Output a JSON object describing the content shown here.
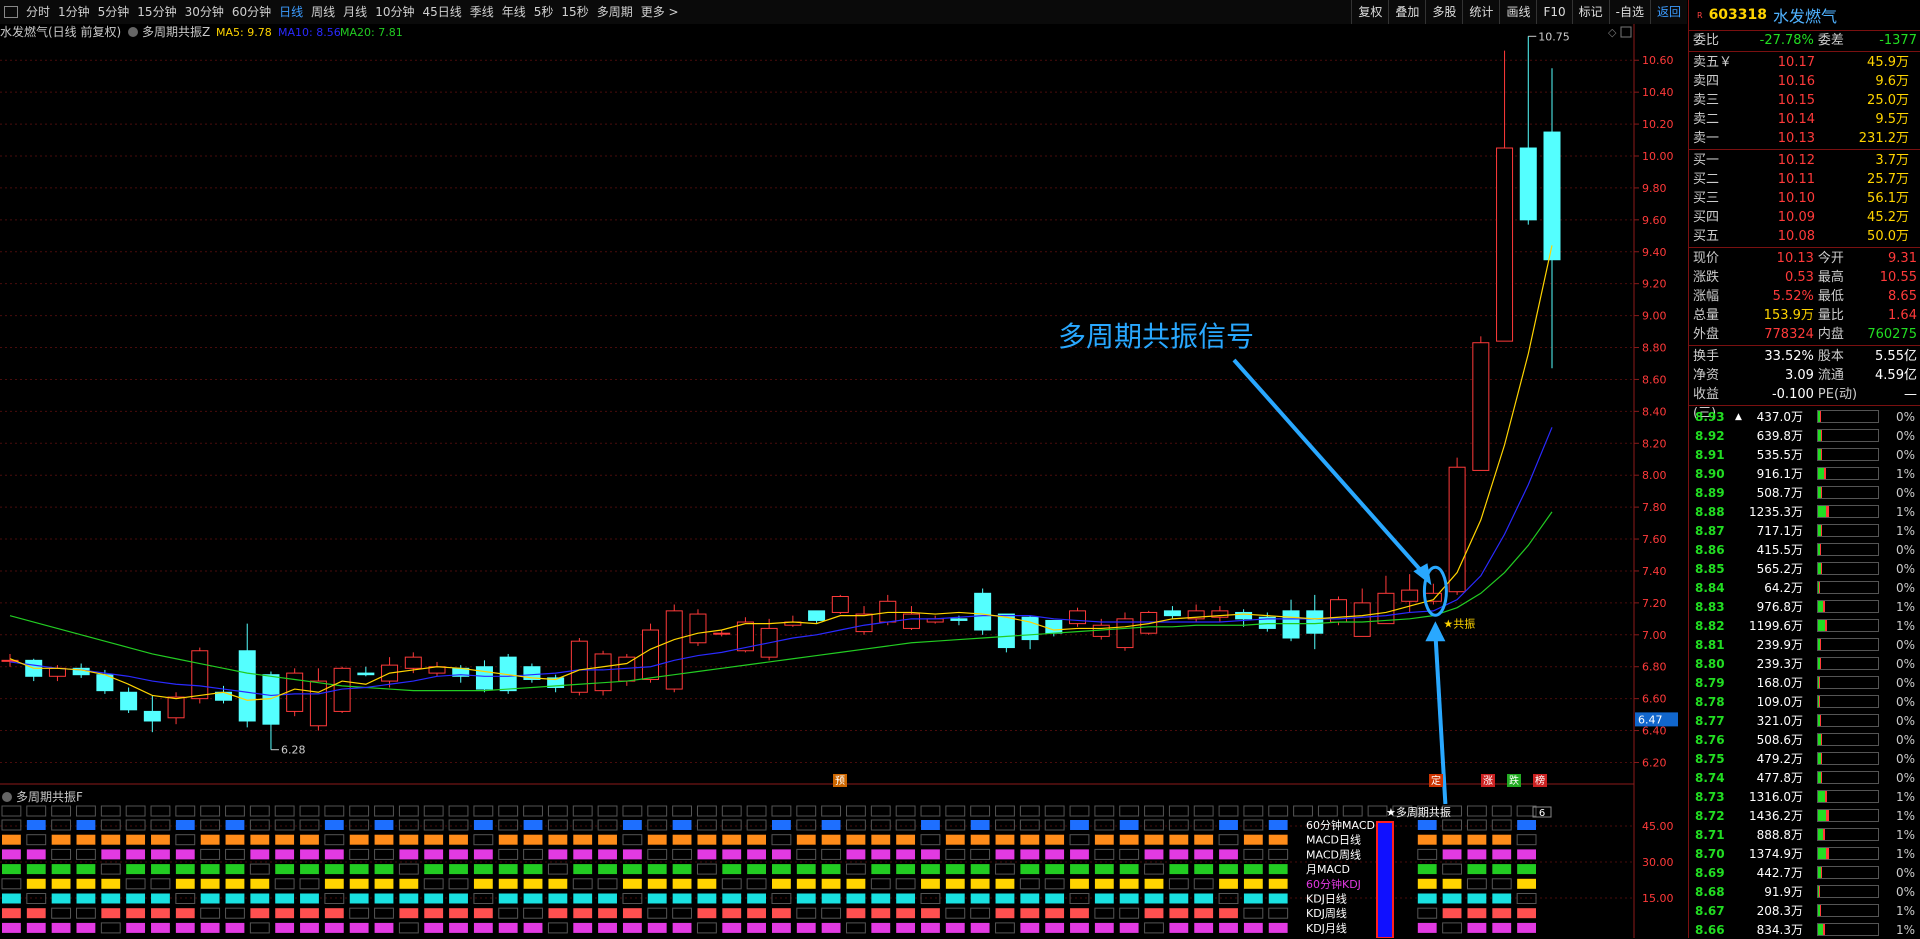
{
  "toolbar": {
    "items": [
      "分时",
      "1分钟",
      "5分钟",
      "15分钟",
      "30分钟",
      "60分钟",
      "日线",
      "周线",
      "月线",
      "10分钟",
      "45日线",
      "季线",
      "年线",
      "5秒",
      "15秒",
      "多周期",
      "更多 >"
    ],
    "active": "日线",
    "right": [
      "复权",
      "叠加",
      "多股",
      "统计",
      "画线",
      "F10",
      "标记",
      "-自选",
      "返回"
    ]
  },
  "chart_header": {
    "title": "水发燃气(日线 前复权)",
    "indicator": "多周期共振Z",
    "ma5": "MA5: 9.78",
    "ma10": "MA10: 8.56",
    "ma20": "MA20: 7.81"
  },
  "price_axis": [
    "10.60",
    "10.40",
    "10.20",
    "10.00",
    "9.80",
    "9.60",
    "9.40",
    "9.20",
    "9.00",
    "8.80",
    "8.60",
    "8.40",
    "8.20",
    "8.00",
    "7.80",
    "7.60",
    "7.40",
    "7.20",
    "7.00",
    "6.80",
    "6.60",
    "6.40",
    "6.20"
  ],
  "price_marker": "6.47",
  "annotations": {
    "high": "10.75",
    "low": "6.28",
    "signal": "多周期共振信号",
    "gongzhen": "★共振",
    "sub_signal": "★多周期共振"
  },
  "tags": [
    "预",
    "定",
    "涨",
    "跌",
    "榜"
  ],
  "chart_data": {
    "type": "candlestick",
    "opens": [
      6.84,
      6.84,
      6.74,
      6.79,
      6.75,
      6.64,
      6.52,
      6.48,
      6.6,
      6.64,
      6.9,
      6.75,
      6.52,
      6.43,
      6.52,
      6.76,
      6.71,
      6.79,
      6.76,
      6.79,
      6.8,
      6.86,
      6.8,
      6.73,
      6.64,
      6.65,
      6.71,
      6.72,
      6.66,
      6.95,
      7.01,
      6.9,
      6.86,
      7.06,
      7.15,
      7.14,
      7.02,
      7.08,
      7.04,
      7.08,
      7.1,
      7.26,
      7.13,
      7.11,
      7.09,
      7.07,
      6.99,
      6.92,
      7.01,
      7.15,
      7.1,
      7.11,
      7.14,
      7.11,
      7.15,
      7.15,
      7.08,
      6.99,
      7.07,
      7.21,
      7.21,
      7.27,
      8.03,
      8.84,
      10.05,
      10.15
    ],
    "closes": [
      6.84,
      6.74,
      6.79,
      6.75,
      6.65,
      6.53,
      6.46,
      6.61,
      6.9,
      6.59,
      6.46,
      6.44,
      6.76,
      6.71,
      6.79,
      6.75,
      6.81,
      6.86,
      6.8,
      6.74,
      6.66,
      6.65,
      6.72,
      6.67,
      6.96,
      6.88,
      6.86,
      7.03,
      7.15,
      7.13,
      7.01,
      7.08,
      7.04,
      7.08,
      7.09,
      7.24,
      7.13,
      7.21,
      7.13,
      7.1,
      7.09,
      7.03,
      6.92,
      6.97,
      7.01,
      7.15,
      7.06,
      7.1,
      7.14,
      7.12,
      7.15,
      7.15,
      7.1,
      7.04,
      6.98,
      7.01,
      7.22,
      7.2,
      7.26,
      7.28,
      7.26,
      8.05,
      8.83,
      10.05,
      9.6,
      9.35
    ],
    "highs": [
      6.88,
      6.85,
      6.81,
      6.82,
      6.78,
      6.67,
      6.62,
      6.64,
      6.92,
      6.68,
      7.07,
      6.77,
      6.79,
      6.79,
      6.8,
      6.8,
      6.86,
      6.89,
      6.83,
      6.81,
      6.84,
      6.88,
      6.82,
      6.75,
      6.98,
      6.9,
      6.88,
      7.07,
      7.19,
      7.16,
      7.03,
      7.11,
      7.1,
      7.12,
      7.14,
      7.25,
      7.18,
      7.25,
      7.18,
      7.12,
      7.12,
      7.29,
      7.13,
      7.12,
      7.07,
      7.17,
      7.1,
      7.14,
      7.15,
      7.18,
      7.19,
      7.18,
      7.16,
      7.14,
      7.22,
      7.25,
      7.24,
      7.29,
      7.37,
      7.38,
      7.32,
      8.11,
      8.87,
      10.66,
      10.75,
      10.55
    ],
    "lows": [
      6.8,
      6.71,
      6.71,
      6.73,
      6.63,
      6.51,
      6.39,
      6.44,
      6.57,
      6.57,
      6.42,
      6.28,
      6.49,
      6.4,
      6.51,
      6.74,
      6.67,
      6.76,
      6.74,
      6.7,
      6.64,
      6.63,
      6.7,
      6.64,
      6.62,
      6.62,
      6.68,
      6.7,
      6.64,
      6.93,
      6.99,
      6.89,
      6.84,
      7.05,
      7.07,
      7.13,
      7.0,
      7.06,
      7.03,
      7.07,
      7.06,
      7.0,
      6.89,
      6.91,
      6.99,
      7.05,
      6.97,
      6.9,
      7.0,
      7.1,
      7.08,
      7.08,
      7.05,
      7.02,
      6.96,
      6.91,
      7.06,
      7.08,
      7.18,
      7.14,
      7.19,
      7.25,
      8.27,
      8.84,
      9.57,
      8.67
    ],
    "ma5": [
      6.85,
      6.79,
      6.79,
      6.78,
      6.75,
      6.69,
      6.62,
      6.6,
      6.62,
      6.64,
      6.59,
      6.6,
      6.66,
      6.64,
      6.71,
      6.69,
      6.76,
      6.78,
      6.8,
      6.79,
      6.77,
      6.75,
      6.73,
      6.72,
      6.78,
      6.8,
      6.82,
      6.91,
      6.97,
      7.01,
      7.03,
      7.07,
      7.07,
      7.08,
      7.07,
      7.12,
      7.12,
      7.14,
      7.14,
      7.13,
      7.14,
      7.13,
      7.11,
      7.08,
      7.03,
      7.04,
      7.04,
      7.05,
      7.07,
      7.1,
      7.11,
      7.12,
      7.13,
      7.12,
      7.11,
      7.1,
      7.11,
      7.12,
      7.14,
      7.18,
      7.22,
      7.39,
      7.72,
      8.19,
      8.76,
      9.44
    ],
    "ma10": [
      6.83,
      6.81,
      6.79,
      6.78,
      6.76,
      6.74,
      6.71,
      6.69,
      6.68,
      6.66,
      6.64,
      6.62,
      6.63,
      6.63,
      6.66,
      6.67,
      6.69,
      6.71,
      6.74,
      6.75,
      6.74,
      6.74,
      6.75,
      6.76,
      6.78,
      6.78,
      6.79,
      6.8,
      6.84,
      6.87,
      6.89,
      6.92,
      6.95,
      6.98,
      7.0,
      7.03,
      7.06,
      7.08,
      7.1,
      7.1,
      7.11,
      7.12,
      7.12,
      7.12,
      7.1,
      7.09,
      7.08,
      7.08,
      7.08,
      7.08,
      7.08,
      7.08,
      7.09,
      7.1,
      7.1,
      7.1,
      7.1,
      7.11,
      7.12,
      7.14,
      7.15,
      7.22,
      7.37,
      7.63,
      7.94,
      8.3
    ],
    "ma20": [
      7.12,
      7.08,
      7.04,
      7.0,
      6.96,
      6.92,
      6.88,
      6.85,
      6.82,
      6.79,
      6.76,
      6.74,
      6.72,
      6.7,
      6.68,
      6.67,
      6.66,
      6.65,
      6.65,
      6.65,
      6.65,
      6.66,
      6.67,
      6.68,
      6.69,
      6.7,
      6.71,
      6.73,
      6.75,
      6.77,
      6.79,
      6.81,
      6.83,
      6.85,
      6.87,
      6.89,
      6.91,
      6.93,
      6.95,
      6.96,
      6.97,
      6.98,
      6.99,
      7.0,
      7.01,
      7.02,
      7.03,
      7.04,
      7.05,
      7.05,
      7.06,
      7.06,
      7.06,
      7.07,
      7.07,
      7.07,
      7.08,
      7.08,
      7.09,
      7.1,
      7.12,
      7.17,
      7.26,
      7.39,
      7.56,
      7.77
    ]
  },
  "sub_panel": {
    "title": "多周期共振F",
    "axis": [
      "45.00",
      "30.00",
      "15.00"
    ],
    "rows": [
      "60分钟MACD",
      "MACD日线",
      "MACD周线",
      "月MACD",
      "60分钟KDJ",
      "KDJ日线",
      "KDJ周线",
      "KDJ月线"
    ],
    "count": "6"
  },
  "side": {
    "code": "603318",
    "name": "水发燃气",
    "r": "R",
    "weibi": {
      "label": "委比",
      "value": "-27.78%",
      "diff_label": "委差",
      "diff": "-1377"
    },
    "asks": [
      {
        "label": "卖五￥",
        "price": "10.17",
        "vol": "45.9万"
      },
      {
        "label": "卖四",
        "price": "10.16",
        "vol": "9.6万"
      },
      {
        "label": "卖三",
        "price": "10.15",
        "vol": "25.0万"
      },
      {
        "label": "卖二",
        "price": "10.14",
        "vol": "9.5万"
      },
      {
        "label": "卖一",
        "price": "10.13",
        "vol": "231.2万"
      }
    ],
    "bids": [
      {
        "label": "买一",
        "price": "10.12",
        "vol": "3.7万"
      },
      {
        "label": "买二",
        "price": "10.11",
        "vol": "25.7万"
      },
      {
        "label": "买三",
        "price": "10.10",
        "vol": "56.1万"
      },
      {
        "label": "买四",
        "price": "10.09",
        "vol": "45.2万"
      },
      {
        "label": "买五",
        "price": "10.08",
        "vol": "50.0万"
      }
    ],
    "stats": [
      {
        "l1": "现价",
        "v1": "10.13",
        "l2": "今开",
        "v2": "9.31"
      },
      {
        "l1": "涨跌",
        "v1": "0.53",
        "l2": "最高",
        "v2": "10.55"
      },
      {
        "l1": "涨幅",
        "v1": "5.52%",
        "l2": "最低",
        "v2": "8.65"
      },
      {
        "l1": "总量",
        "v1": "153.9万",
        "l2": "量比",
        "v2": "1.64"
      },
      {
        "l1": "外盘",
        "v1": "778324",
        "l2": "内盘",
        "v2": "760275"
      }
    ],
    "stats2": [
      {
        "l1": "换手",
        "v1": "33.52%",
        "l2": "股本",
        "v2": "5.55亿"
      },
      {
        "l1": "净资",
        "v1": "3.09",
        "l2": "流通",
        "v2": "4.59亿"
      },
      {
        "l1": "收益(三)",
        "v1": "-0.100",
        "l2": "PE(动)",
        "v2": "—"
      }
    ],
    "quotes": [
      {
        "p": "8.93",
        "v": "437.0万",
        "pct": "0%",
        "up": true
      },
      {
        "p": "8.92",
        "v": "639.8万",
        "pct": "0%"
      },
      {
        "p": "8.91",
        "v": "535.5万",
        "pct": "0%"
      },
      {
        "p": "8.90",
        "v": "916.1万",
        "pct": "1%"
      },
      {
        "p": "8.89",
        "v": "508.7万",
        "pct": "0%"
      },
      {
        "p": "8.88",
        "v": "1235.3万",
        "pct": "1%"
      },
      {
        "p": "8.87",
        "v": "717.1万",
        "pct": "1%"
      },
      {
        "p": "8.86",
        "v": "415.5万",
        "pct": "0%"
      },
      {
        "p": "8.85",
        "v": "565.2万",
        "pct": "0%"
      },
      {
        "p": "8.84",
        "v": "64.2万",
        "pct": "0%"
      },
      {
        "p": "8.83",
        "v": "976.8万",
        "pct": "1%"
      },
      {
        "p": "8.82",
        "v": "1199.6万",
        "pct": "1%"
      },
      {
        "p": "8.81",
        "v": "239.9万",
        "pct": "0%"
      },
      {
        "p": "8.80",
        "v": "239.3万",
        "pct": "0%"
      },
      {
        "p": "8.79",
        "v": "168.0万",
        "pct": "0%"
      },
      {
        "p": "8.78",
        "v": "109.0万",
        "pct": "0%"
      },
      {
        "p": "8.77",
        "v": "321.0万",
        "pct": "0%"
      },
      {
        "p": "8.76",
        "v": "508.6万",
        "pct": "0%"
      },
      {
        "p": "8.75",
        "v": "479.2万",
        "pct": "0%"
      },
      {
        "p": "8.74",
        "v": "477.8万",
        "pct": "0%"
      },
      {
        "p": "8.73",
        "v": "1316.0万",
        "pct": "1%"
      },
      {
        "p": "8.72",
        "v": "1436.2万",
        "pct": "1%"
      },
      {
        "p": "8.71",
        "v": "888.8万",
        "pct": "1%"
      },
      {
        "p": "8.70",
        "v": "1374.9万",
        "pct": "1%"
      },
      {
        "p": "8.69",
        "v": "442.7万",
        "pct": "0%"
      },
      {
        "p": "8.68",
        "v": "91.9万",
        "pct": "0%"
      },
      {
        "p": "8.67",
        "v": "208.3万",
        "pct": "1%"
      },
      {
        "p": "8.66",
        "v": "834.3万",
        "pct": "1%"
      }
    ]
  }
}
